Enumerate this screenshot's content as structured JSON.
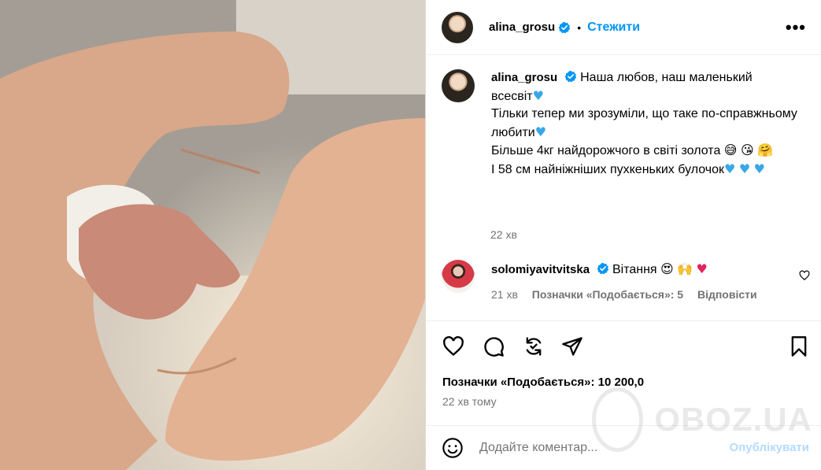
{
  "photo": {
    "alt": "Hands forming a heart around a newborn's hand"
  },
  "header": {
    "username": "alina_grosu",
    "separator": "•",
    "follow_label": "Стежити",
    "more_label": "•••"
  },
  "caption": {
    "username": "alina_grosu",
    "line1": "Наша любов, наш маленький всесвіт",
    "line2": "Тільки тепер ми зрозуміли, що таке по-справжньому любити",
    "line3": "Більше 4кг найдорожчого в світі золота",
    "line4": "І 58 см найніжніших пухкеньких булочок",
    "time": "22 хв"
  },
  "comment": {
    "username": "solomiyavitvitska",
    "text": "Вітання",
    "time": "21 хв",
    "likes": "Позначки «Подобається»: 5",
    "reply_label": "Відповісти"
  },
  "post": {
    "likes": "Позначки «Подобається»: 10 200,0",
    "time": "22 хв тому"
  },
  "composer": {
    "placeholder": "Додайте коментар...",
    "publish_label": "Опублікувати"
  },
  "watermark": {
    "text": "OBOZ.UA"
  },
  "colors": {
    "accent": "#0095f6",
    "verified": "#0095f6",
    "muted": "#737373"
  },
  "icons": [
    "verified-icon",
    "more-icon",
    "heart-icon",
    "comment-icon",
    "repost-icon",
    "share-icon",
    "bookmark-icon",
    "emoji-icon"
  ]
}
